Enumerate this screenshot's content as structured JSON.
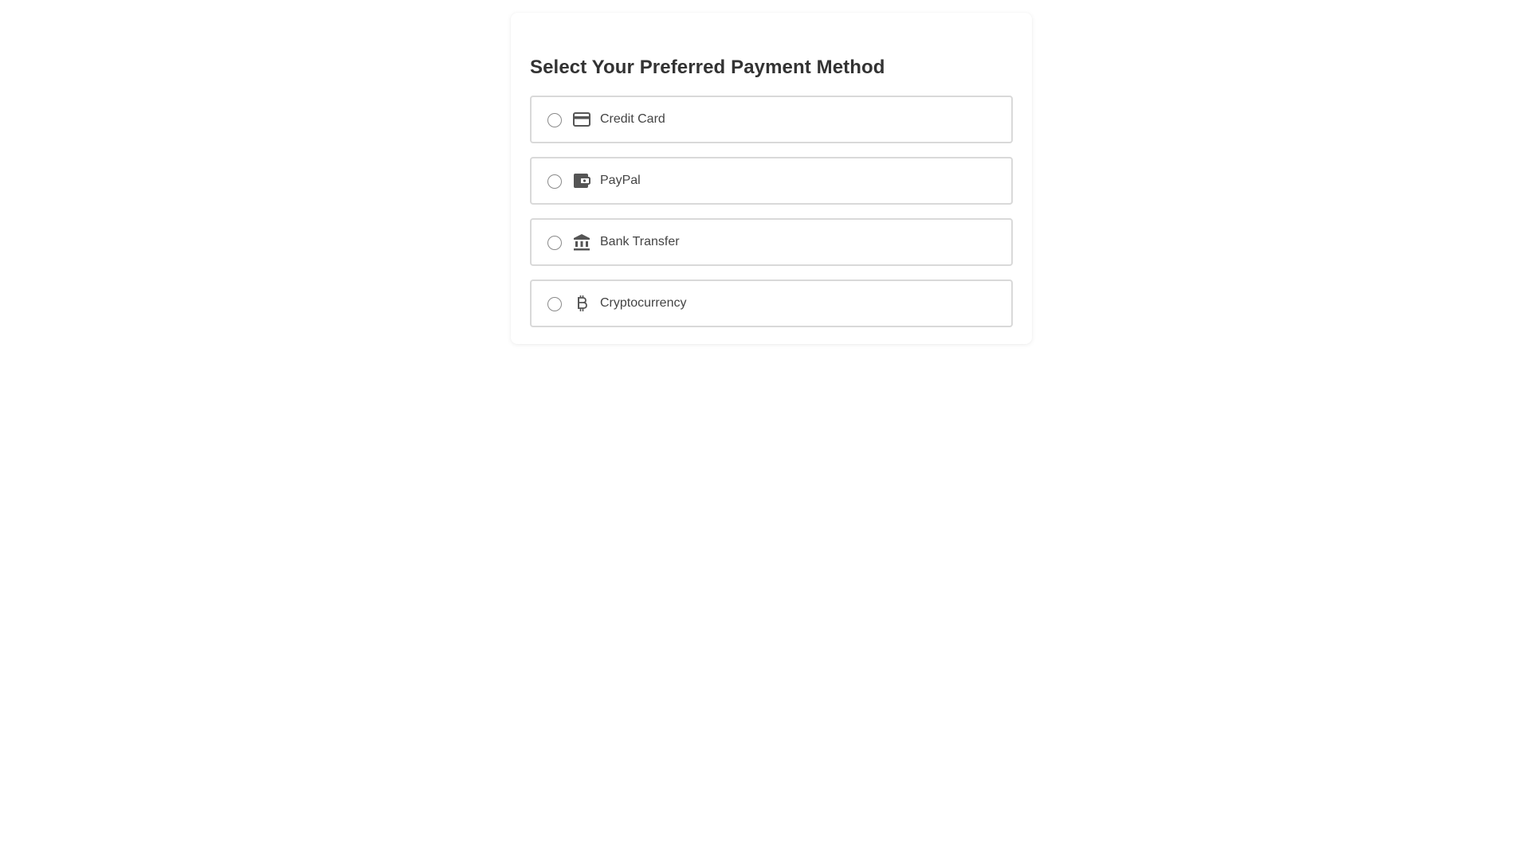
{
  "form": {
    "title": "Select Your Preferred Payment Method",
    "options": [
      {
        "label": "Credit Card",
        "icon": "credit-card-icon",
        "selected": false
      },
      {
        "label": "PayPal",
        "icon": "wallet-icon",
        "selected": false
      },
      {
        "label": "Bank Transfer",
        "icon": "bank-icon",
        "selected": false
      },
      {
        "label": "Cryptocurrency",
        "icon": "bitcoin-icon",
        "selected": false
      }
    ]
  },
  "colors": {
    "title": "#333333",
    "label": "#444444",
    "icon": "#555555",
    "border": "#d9d9d9",
    "radio_border": "#8a8a8a"
  }
}
